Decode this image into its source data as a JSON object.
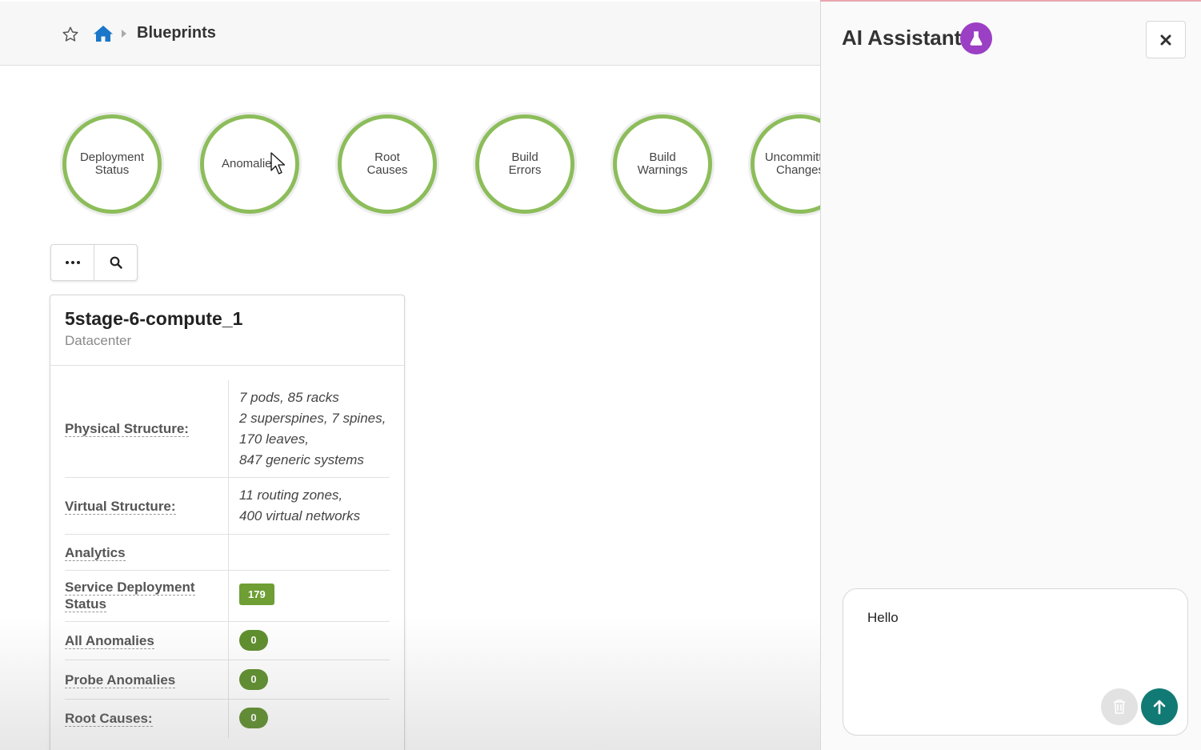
{
  "header": {
    "breadcrumb_title": "Blueprints"
  },
  "gauges": [
    {
      "name": "gauge-deployment-status",
      "label": "Deployment\nStatus"
    },
    {
      "name": "gauge-anomalies",
      "label": "Anomalies"
    },
    {
      "name": "gauge-root-causes",
      "label": "Root\nCauses"
    },
    {
      "name": "gauge-build-errors",
      "label": "Build\nErrors"
    },
    {
      "name": "gauge-build-warnings",
      "label": "Build\nWarnings"
    },
    {
      "name": "gauge-uncommitted-changes",
      "label": "Uncommitted\nChanges"
    }
  ],
  "card": {
    "title": "5stage-6-compute_1",
    "subtitle": "Datacenter",
    "rows": {
      "physical": {
        "label": "Physical Structure:",
        "value": "7 pods, 85 racks\n2 superspines, 7 spines,\n170 leaves,\n847 generic systems"
      },
      "virtual": {
        "label": "Virtual Structure:",
        "value": "11 routing zones,\n400 virtual networks"
      },
      "analytics": {
        "label": "Analytics"
      },
      "service": {
        "label": "Service Deployment Status",
        "value": "179"
      },
      "all_anomalies": {
        "label": "All Anomalies",
        "value": "0"
      },
      "probe_anomalies": {
        "label": "Probe Anomalies",
        "value": "0"
      },
      "root_causes": {
        "label": "Root Causes:",
        "value": "0"
      }
    }
  },
  "assistant": {
    "title": "AI Assistant",
    "input_value": "Hello"
  },
  "colors": {
    "gauge_ring": "#8cbd5a",
    "badge_green": "#6e9e34",
    "assistant_accent": "#9b3fc4",
    "send_button": "#117a74",
    "home_icon": "#1a77c9"
  }
}
